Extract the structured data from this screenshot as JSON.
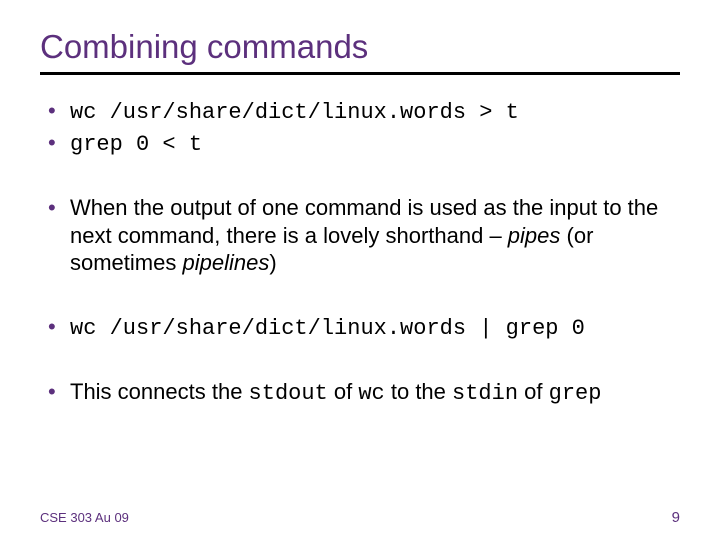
{
  "title": "Combining commands",
  "bullets": {
    "b1": "wc /usr/share/dict/linux.words > t",
    "b2": "grep 0 < t",
    "b3_pre": "When the output of one command is used as the input to the next command, there is a lovely shorthand – ",
    "b3_pipes": "pipes",
    "b3_mid": " (or sometimes ",
    "b3_pipelines": "pipelines",
    "b3_post": ")",
    "b4": "wc /usr/share/dict/linux.words | grep 0",
    "b5_pre": "This connects the ",
    "b5_stdout": "stdout",
    "b5_mid1": " of ",
    "b5_wc": "wc",
    "b5_mid2": " to the ",
    "b5_stdin": "stdin",
    "b5_mid3": " of ",
    "b5_grep": "grep"
  },
  "footer": {
    "left": "CSE 303 Au 09",
    "right": "9"
  }
}
